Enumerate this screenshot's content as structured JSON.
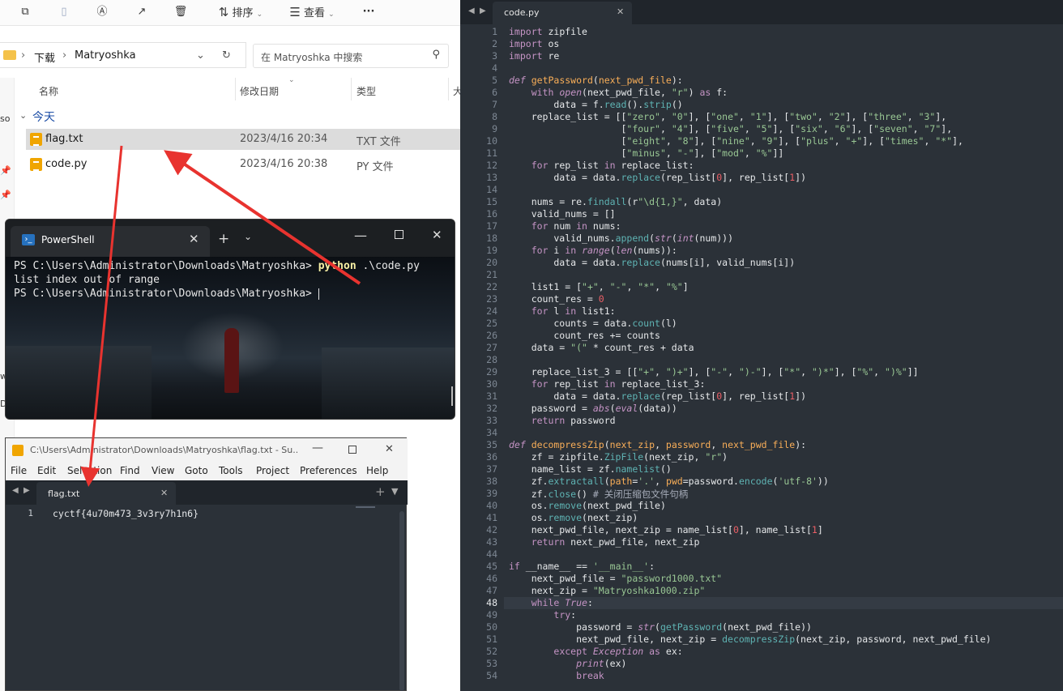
{
  "explorer": {
    "toolbar": {
      "sort_label": "排序",
      "view_label": "查看",
      "more_label": "···"
    },
    "breadcrumb": [
      "下载",
      "Matryoshka"
    ],
    "search_placeholder": "在 Matryoshka 中搜索",
    "columns": {
      "name": "名称",
      "modified": "修改日期",
      "type": "类型",
      "size": "大"
    },
    "group": "今天",
    "files": [
      {
        "name": "flag.txt",
        "modified": "2023/4/16 20:34",
        "type": "TXT 文件"
      },
      {
        "name": "code.py",
        "modified": "2023/4/16 20:38",
        "type": "PY 文件"
      }
    ],
    "side_fragments": [
      "so",
      "w",
      "Da"
    ]
  },
  "powershell": {
    "tab_title": "PowerShell",
    "lines": [
      {
        "prompt": "PS C:\\Users\\Administrator\\Downloads\\Matryoshka> ",
        "cmd": "python",
        "args": " .\\code.py"
      },
      {
        "text": "list index out of range"
      },
      {
        "prompt": "PS C:\\Users\\Administrator\\Downloads\\Matryoshka> "
      }
    ]
  },
  "sublime_small": {
    "title": "C:\\Users\\Administrator\\Downloads\\Matryoshka\\flag.txt - Su...",
    "menu": [
      "File",
      "Edit",
      "Selection",
      "Find",
      "View",
      "Goto",
      "Tools",
      "Project",
      "Preferences",
      "Help"
    ],
    "tab": "flag.txt",
    "line_number": "1",
    "content": "cyctf{4u70m473_3v3ry7h1n6}"
  },
  "sublime_code": {
    "tab": "code.py",
    "current_line": 48,
    "line_count": 54
  },
  "colors": {
    "editor_bg": "#2b3138",
    "keyword": "#c594c5",
    "string": "#99c794",
    "function": "#f9ae58",
    "arrow": "#e8332f"
  }
}
